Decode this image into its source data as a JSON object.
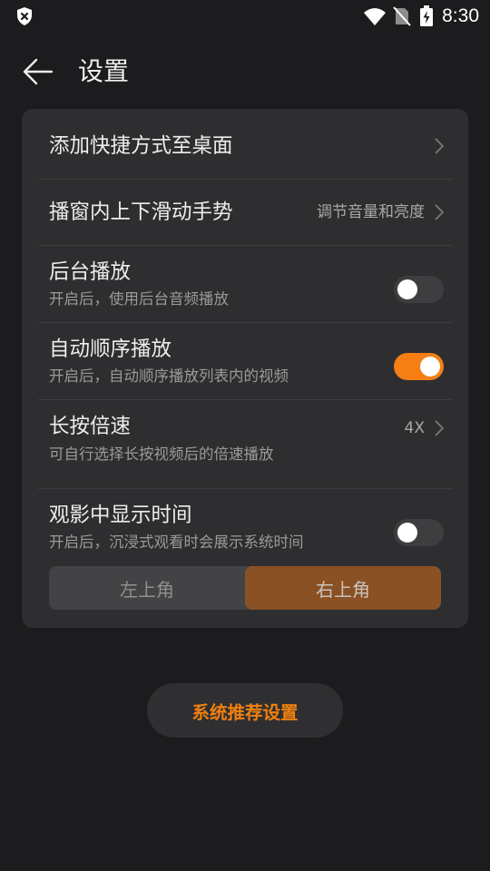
{
  "status_bar": {
    "time": "8:30",
    "icons": [
      "shield-x-icon",
      "wifi-icon",
      "no-sim-icon",
      "battery-charging-icon"
    ]
  },
  "header": {
    "back_icon": "back-arrow-icon",
    "title": "设置"
  },
  "settings": {
    "shortcut": {
      "title": "添加快捷方式至桌面",
      "icon": "chevron-right-icon"
    },
    "gesture": {
      "title": "播窗内上下滑动手势",
      "value": "调节音量和亮度",
      "icon": "chevron-right-icon"
    },
    "background_play": {
      "title": "后台播放",
      "subtitle": "开启后，使用后台音频播放",
      "enabled": false
    },
    "auto_play": {
      "title": "自动顺序播放",
      "subtitle": "开启后，自动顺序播放列表内的视频",
      "enabled": true
    },
    "long_press_speed": {
      "title": "长按倍速",
      "subtitle": "可自行选择长按视频后的倍速播放",
      "value": "4X",
      "icon": "chevron-right-icon"
    },
    "show_time": {
      "title": "观影中显示时间",
      "subtitle": "开启后，沉浸式观看时会展示系统时间",
      "enabled": false,
      "position_options": [
        "左上角",
        "右上角"
      ],
      "selected_position": "右上角"
    }
  },
  "recommend_button": {
    "label": "系统推荐设置"
  },
  "colors": {
    "accent": "#f57f15",
    "background": "#1c1c1e",
    "card": "#2e2e30",
    "selected_segment": "#8a5124"
  }
}
